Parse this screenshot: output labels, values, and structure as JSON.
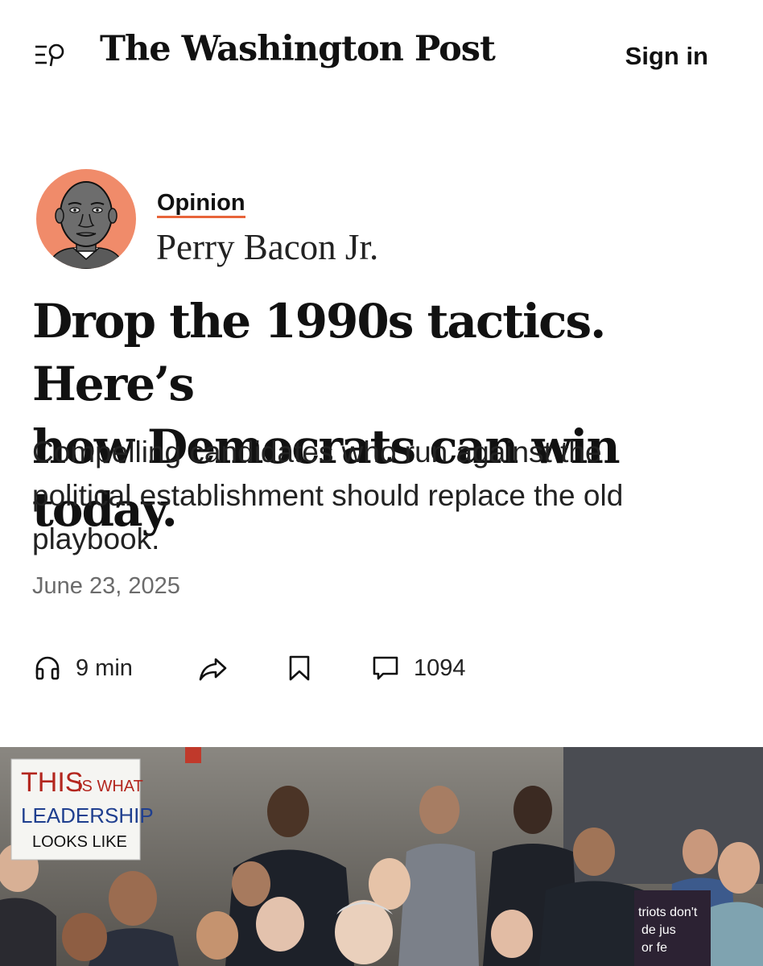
{
  "header": {
    "masthead": "The Washington Post",
    "sign_in_label": "Sign in",
    "menu_icon": "menu-search-icon"
  },
  "byline": {
    "section": "Opinion",
    "author": "Perry Bacon Jr.",
    "avatar_bg": "#f08b6a"
  },
  "article": {
    "headline_line1": "Drop the 1990s tactics. Here’s",
    "headline_line2": "how Democrats can win today.",
    "dek_line1": "Compelling candidates who run against the",
    "dek_line2": "political establishment should replace the old",
    "dek_line3": "playbook.",
    "date": "June 23, 2025"
  },
  "toolbar": {
    "listen_label": "9 min",
    "comments_count": "1094",
    "icons": [
      "headphones-icon",
      "share-icon",
      "bookmark-icon",
      "comment-icon"
    ]
  },
  "photo": {
    "sign_line1_a": "THIS",
    "sign_line1_b": "IS WHAT",
    "sign_line2": "LEADERSHIP",
    "sign_line3": "LOOKS LIKE",
    "banner_line1": "triots don't",
    "banner_line2": "de jus",
    "banner_line3": "or fe"
  },
  "colors": {
    "accent_underline": "#e8643a",
    "text": "#111111",
    "muted": "#6b6b6b"
  }
}
